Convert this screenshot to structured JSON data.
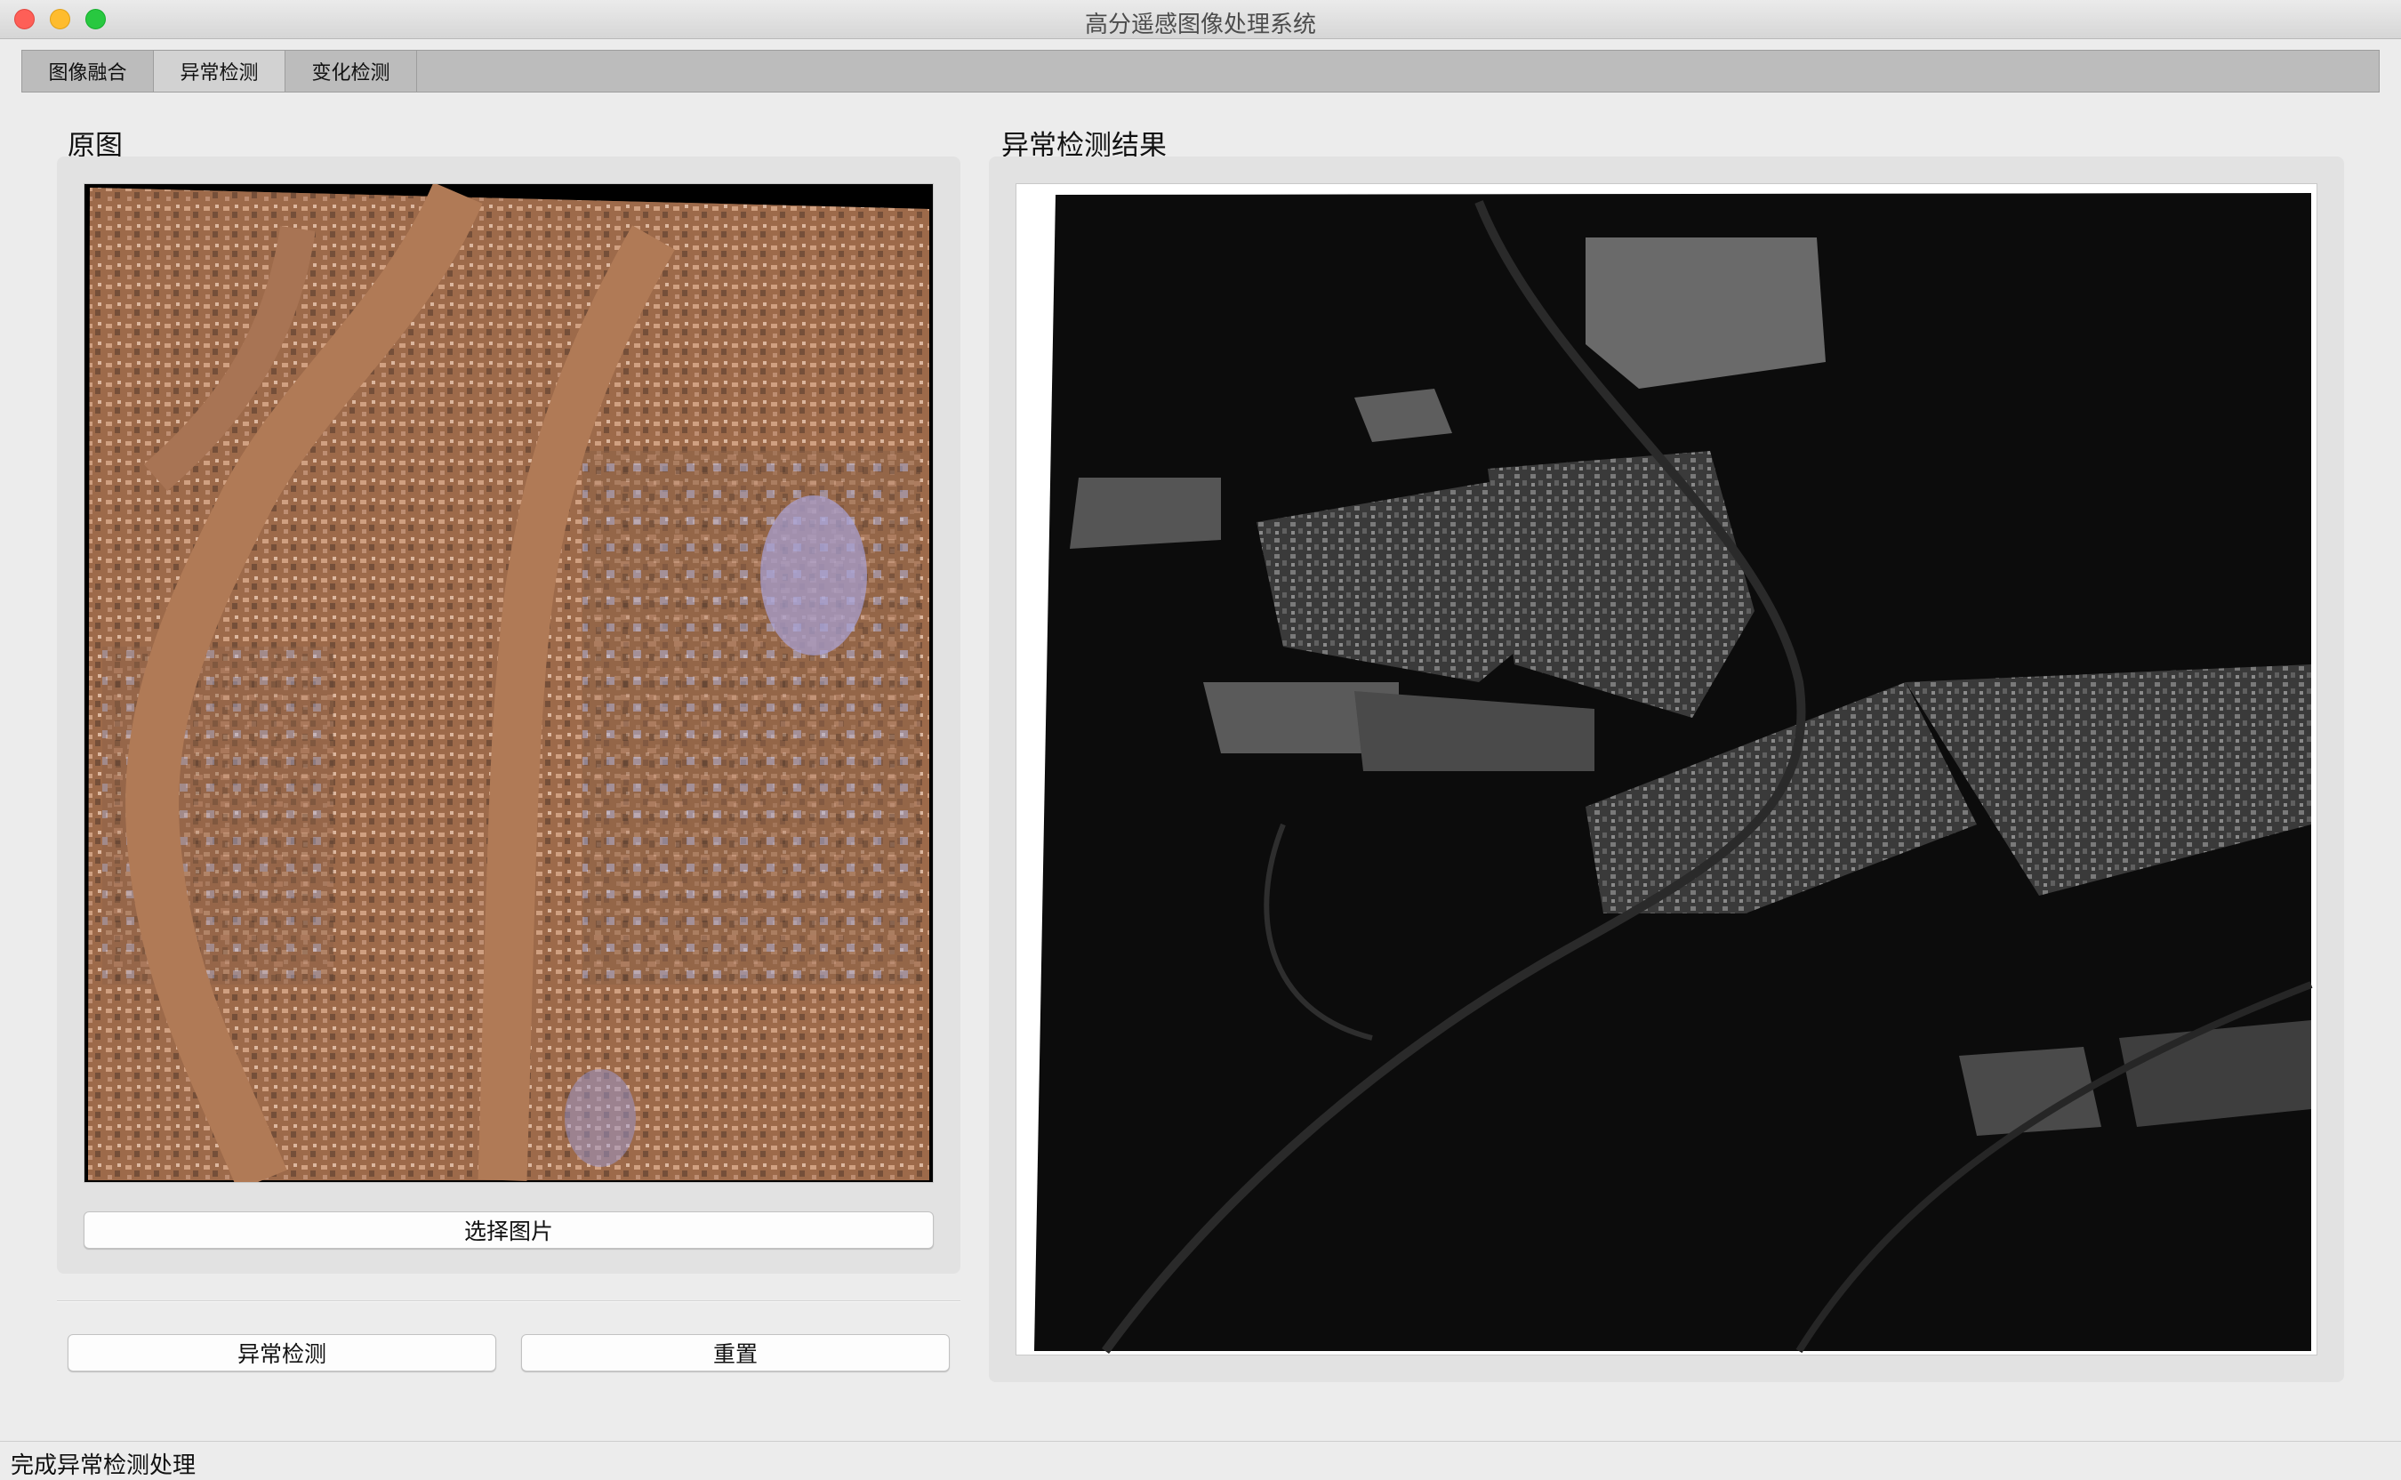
{
  "window": {
    "title": "高分遥感图像处理系统"
  },
  "tabs": [
    {
      "label": "图像融合"
    },
    {
      "label": "异常检测"
    },
    {
      "label": "变化检测"
    }
  ],
  "left_panel": {
    "heading": "原图",
    "select_button": "选择图片"
  },
  "right_panel": {
    "heading": "异常检测结果"
  },
  "actions": {
    "detect_button": "异常检测",
    "reset_button": "重置"
  },
  "status": {
    "message": "完成异常检测处理"
  }
}
